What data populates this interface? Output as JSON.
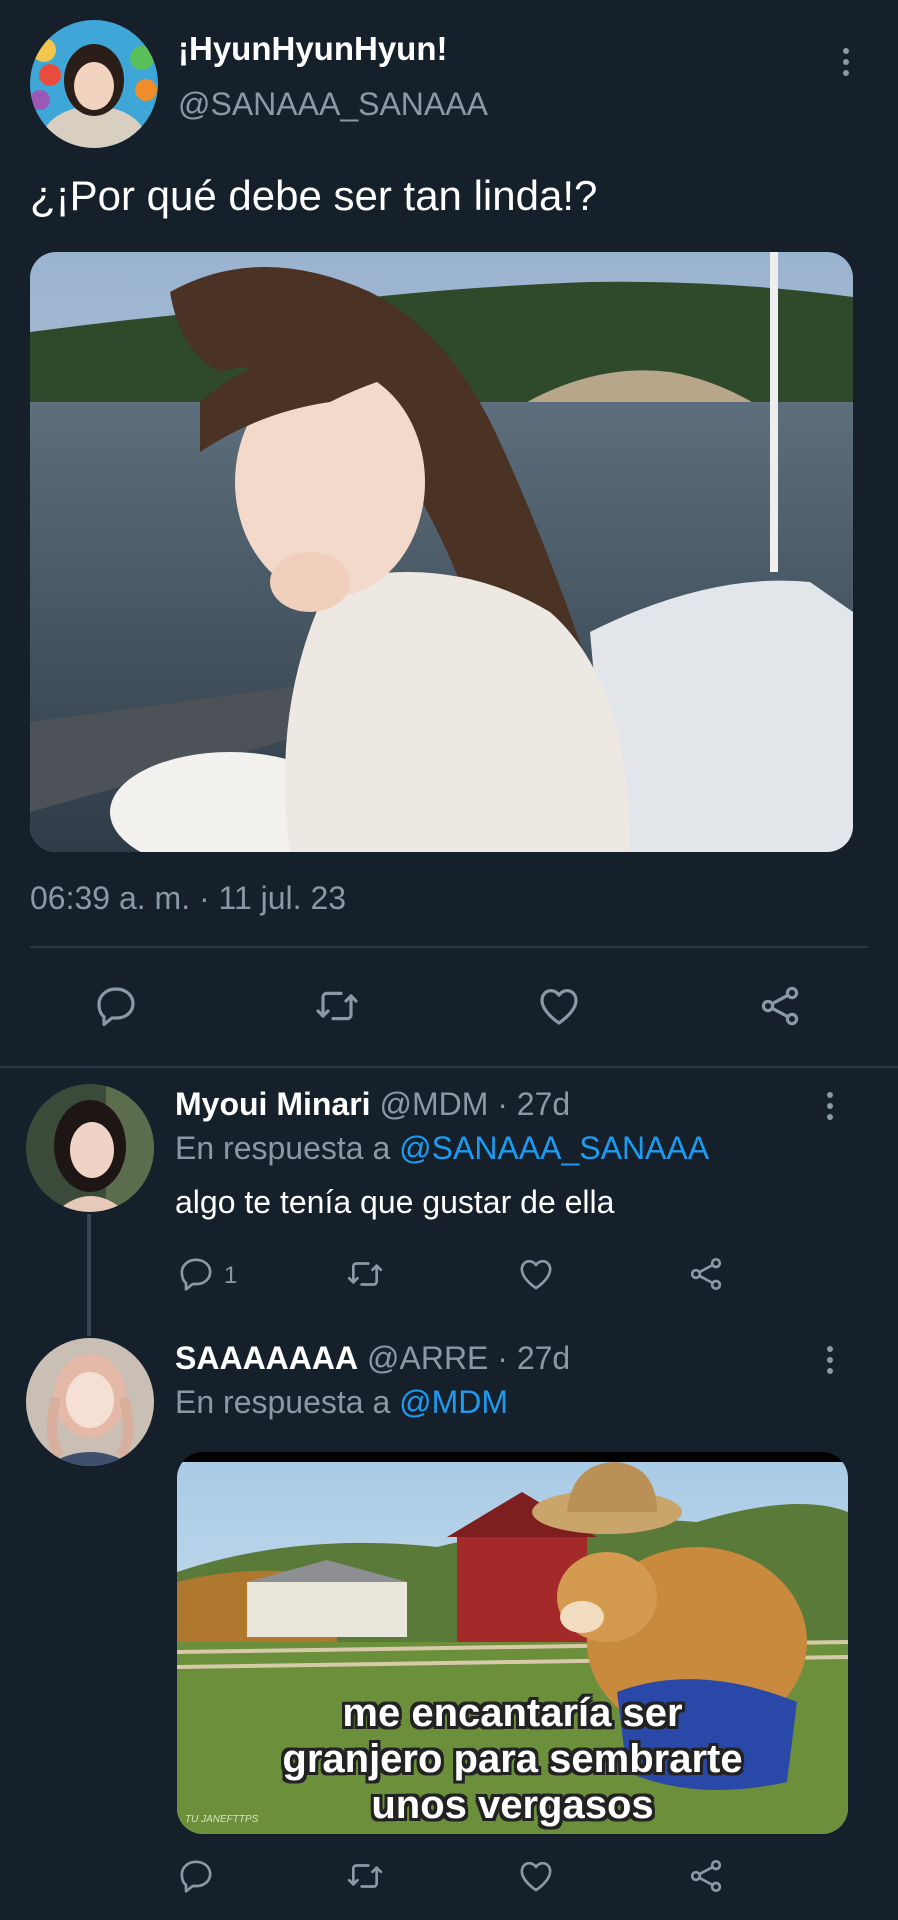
{
  "main_tweet": {
    "display_name": "¡HyunHyunHyun!",
    "handle": "@SANAAA_SANAAA",
    "text": "¿¡Por qué debe ser tan linda!?",
    "timestamp": "06:39 a. m. · 11 jul. 23",
    "icons": [
      "reply-icon",
      "retweet-icon",
      "like-icon",
      "share-icon"
    ]
  },
  "replies": [
    {
      "display_name": "Myoui Minari",
      "handle": "@MDM",
      "age": "· 27d",
      "in_reply_prefix": "En respuesta a",
      "in_reply_to": "@SANAAA_SANAAA",
      "text": "algo te tenía que gustar de ella",
      "reply_count": "1"
    },
    {
      "display_name": "SAAAAAAA",
      "handle": "@ARRE",
      "age": "· 27d",
      "in_reply_prefix": "En respuesta a",
      "in_reply_to": "@MDM",
      "meme_caption_1": "me encantaría ser",
      "meme_caption_2": "granjero para sembrarte",
      "meme_caption_3": "unos vergasos",
      "meme_watermark": "TU JANEFTTPS"
    }
  ],
  "colors": {
    "background": "#15202b",
    "muted": "#8b98a5",
    "link": "#1d9bf0"
  }
}
